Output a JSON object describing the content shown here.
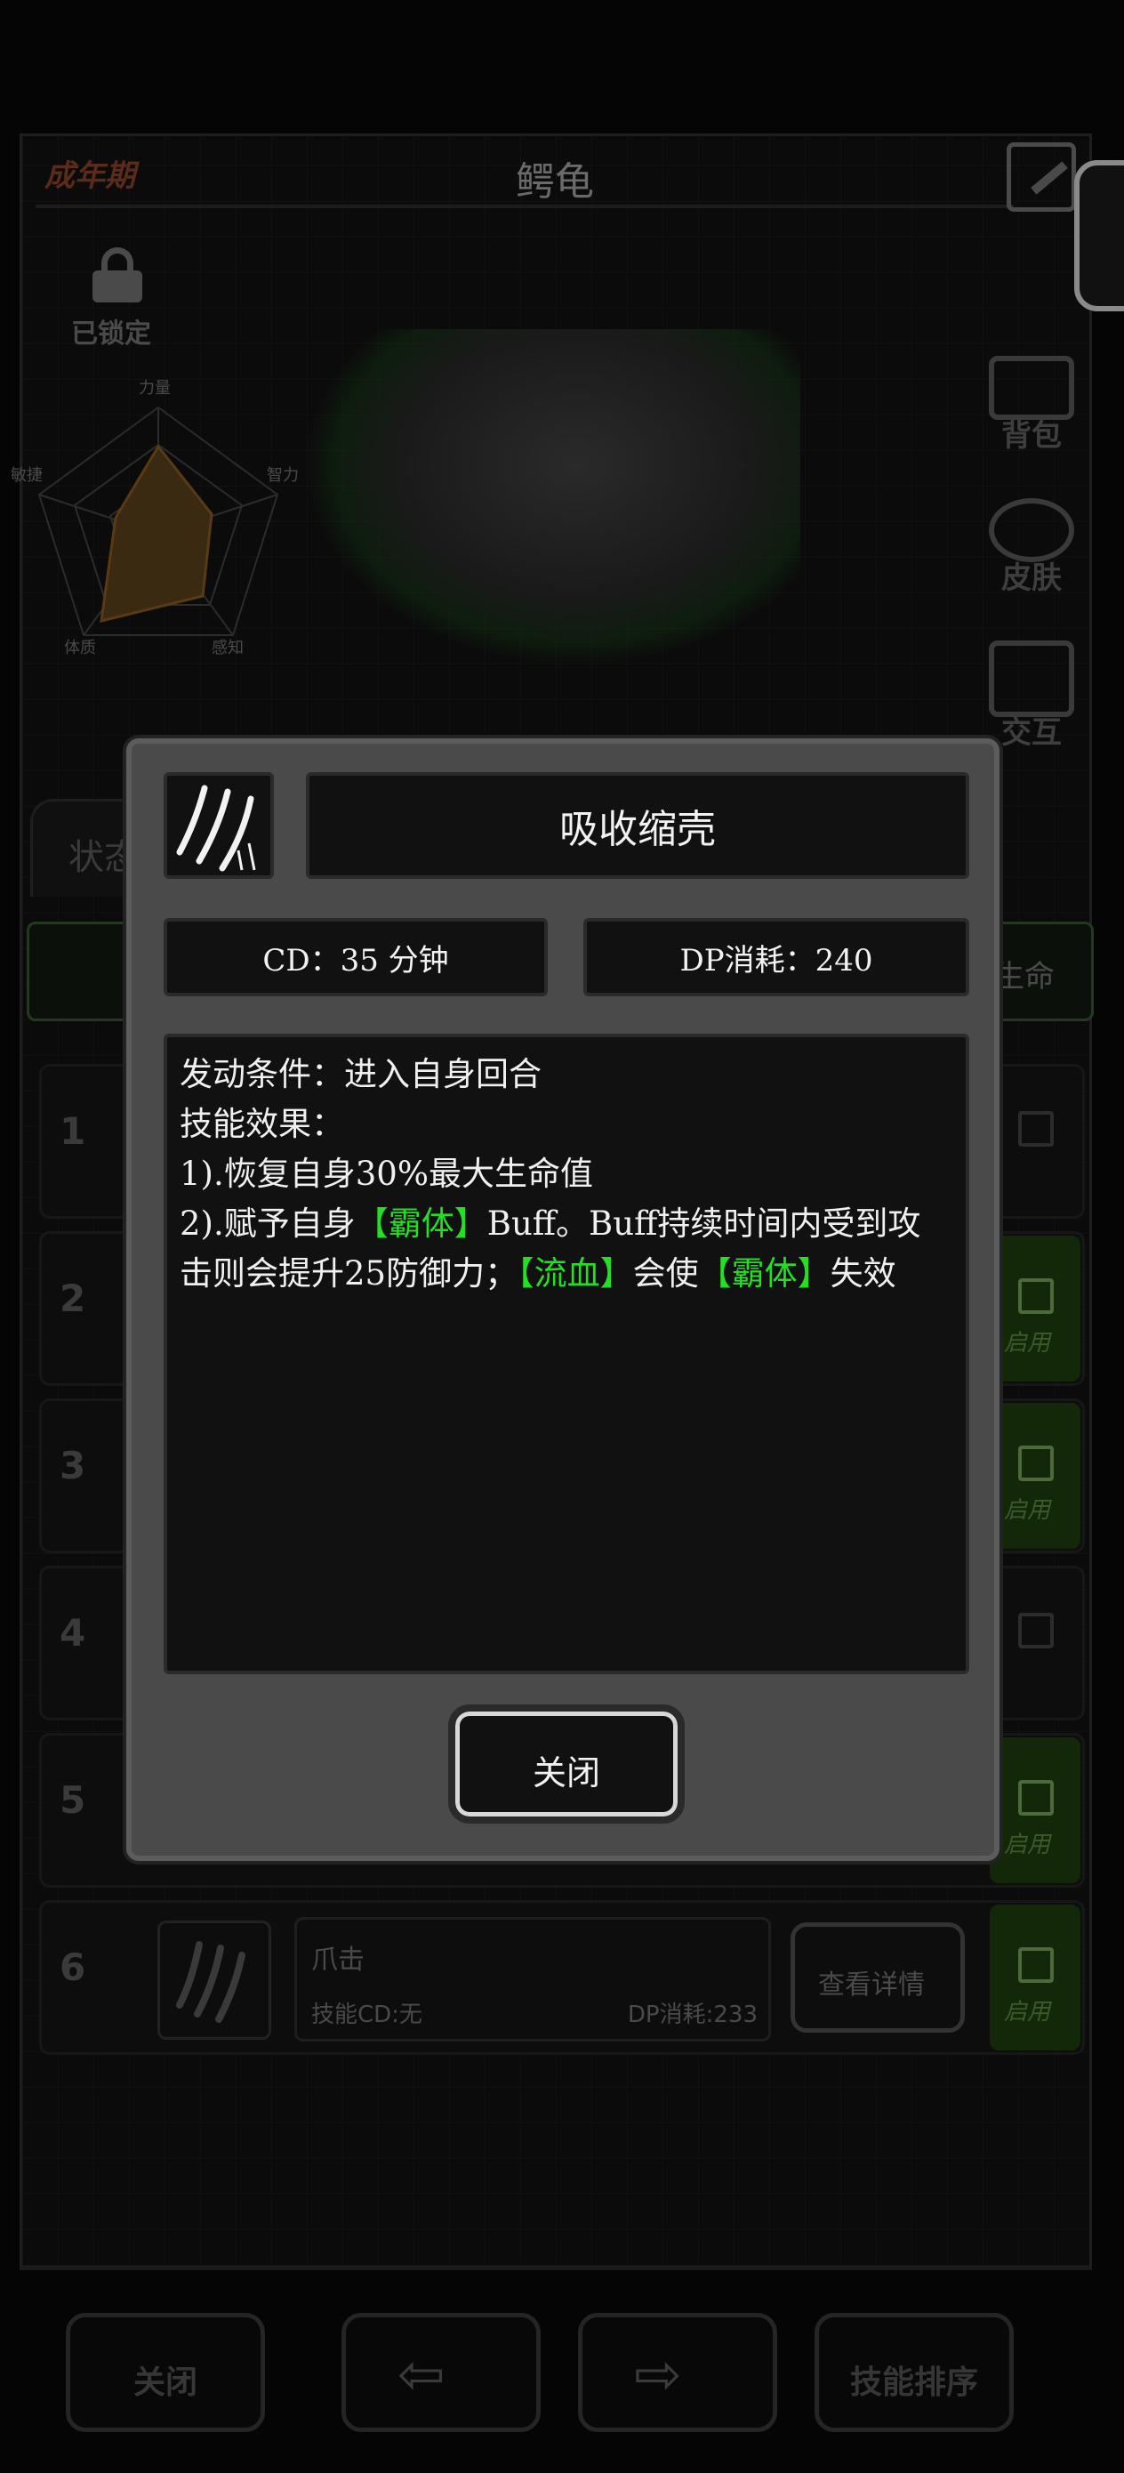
{
  "pet": {
    "stage": "成年期",
    "name": "鳄龟",
    "lock_label": "已锁定",
    "stats": [
      "力量",
      "智力",
      "感知",
      "体质",
      "敏捷"
    ]
  },
  "side_menu": {
    "bag": "背包",
    "skin": "皮肤",
    "interact": "交互"
  },
  "tabs": {
    "state": "状态"
  },
  "filter": {
    "life": "生命"
  },
  "skill_rows": {
    "labels": [
      "1",
      "2",
      "3",
      "4",
      "5",
      "6"
    ],
    "enable_label": "启用",
    "row6": {
      "name": "爪击",
      "cd": "技能CD:无",
      "dp": "DP消耗:233",
      "detail_button": "查看详情"
    }
  },
  "bottom_bar": {
    "close": "关闭",
    "sort": "技能排序"
  },
  "dialog": {
    "title": "吸收缩壳",
    "cd": "CD：35 分钟",
    "dp": "DP消耗：240",
    "desc": {
      "line1": "发动条件：进入自身回合",
      "line2": "技能效果：",
      "line3": "1).恢复自身30%最大生命值",
      "l4_a": "2).赋予自身",
      "l4_hl1": "【霸体】",
      "l4_b": "Buff。Buff持续时间内受到攻击则会提升25防御力；",
      "l4_hl2": "【流血】",
      "l4_c": "会使",
      "l4_hl3": "【霸体】",
      "l4_d": "失效"
    },
    "close_button": "关闭"
  },
  "colors": {
    "highlight": "#23e023",
    "dialog_bg": "#4a4a4a",
    "panel_bg": "#111111"
  }
}
